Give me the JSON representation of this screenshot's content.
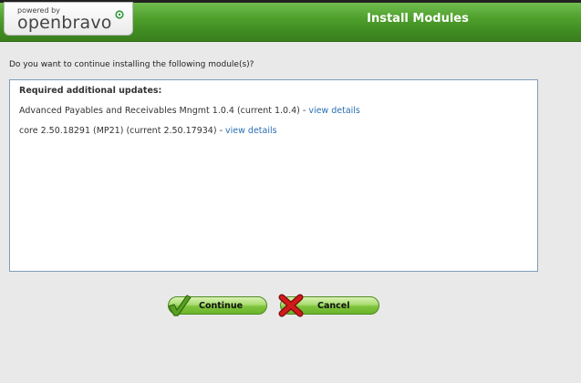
{
  "header": {
    "logo_powered": "powered by",
    "logo_brand": "openbravo",
    "title": "Install Modules"
  },
  "main": {
    "question": "Do you want to continue installing the following module(s)?",
    "panel_heading": "Required additional updates:",
    "modules": [
      {
        "text": "Advanced Payables and Receivables Mngmt 1.0.4 (current 1.0.4) - ",
        "link": "view details"
      },
      {
        "text": "core 2.50.18291 (MP21) (current 2.50.17934) - ",
        "link": "view details"
      }
    ]
  },
  "buttons": {
    "continue_label": "Continue",
    "cancel_label": "Cancel"
  },
  "colors": {
    "header_green": "#4f9f2c",
    "link_blue": "#2a6fb3",
    "button_green": "#7fc43e",
    "cancel_red": "#d11a1a",
    "check_green": "#5aa020"
  },
  "icons": {
    "continue": "checkmark-icon",
    "cancel": "red-x-icon",
    "brand": "openbravo-logo-icon"
  }
}
